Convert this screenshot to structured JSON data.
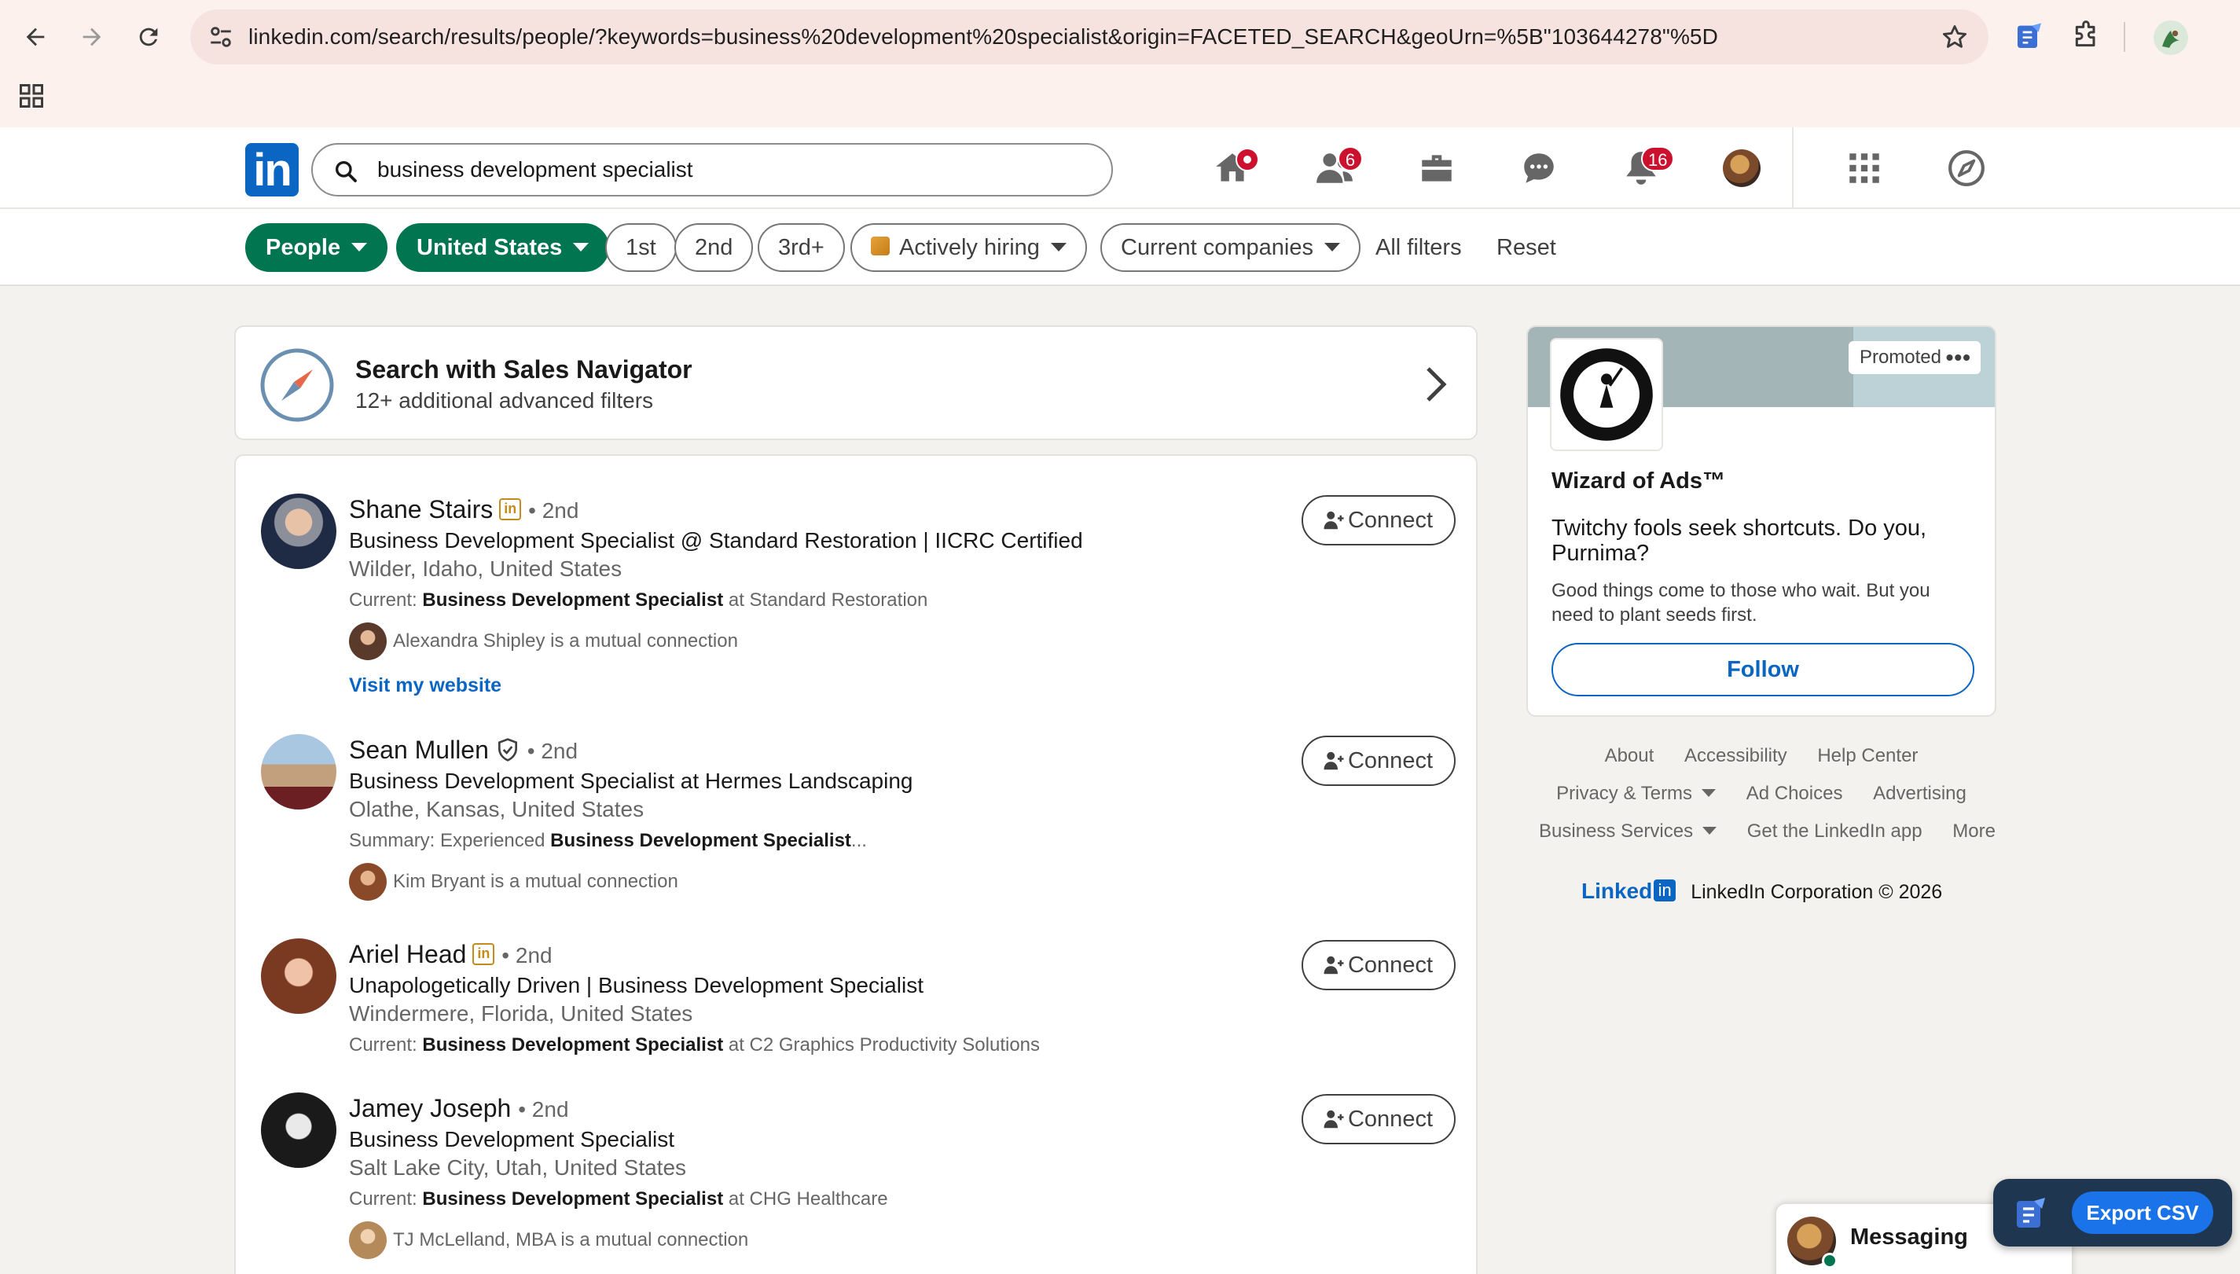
{
  "browser": {
    "url": "linkedin.com/search/results/people/?keywords=business%20development%20specialist&origin=FACETED_SEARCH&geoUrn=%5B\"103644278\"%5D"
  },
  "header": {
    "logo_text": "in",
    "search_value": "business development specialist",
    "badges": {
      "network": "6",
      "notifications": "16"
    }
  },
  "filters": {
    "people": "People",
    "location": "United States",
    "first": "1st",
    "second": "2nd",
    "third": "3rd+",
    "hiring": "Actively hiring",
    "companies": "Current companies",
    "all_filters": "All filters",
    "reset": "Reset"
  },
  "sales_nav": {
    "title": "Search with Sales Navigator",
    "subtitle": "12+ additional advanced filters"
  },
  "results": [
    {
      "name": "Shane Stairs",
      "degree": "• 2nd",
      "headline": "Business Development Specialist @ Standard Restoration | IICRC Certified",
      "location": "Wilder, Idaho, United States",
      "current_prefix": "Current: ",
      "current_bold": "Business Development Specialist",
      "current_suffix": " at Standard Restoration",
      "mutual": "Alexandra Shipley is a mutual connection",
      "link": "Visit my website",
      "connect": "Connect"
    },
    {
      "name": "Sean Mullen",
      "degree": "• 2nd",
      "headline": "Business Development Specialist at Hermes Landscaping",
      "location": "Olathe, Kansas, United States",
      "current_prefix": "Summary: Experienced ",
      "current_bold": "Business Development Specialist",
      "current_suffix": "...",
      "mutual": "Kim Bryant is a mutual connection",
      "connect": "Connect"
    },
    {
      "name": "Ariel Head",
      "degree": "• 2nd",
      "headline": "Unapologetically Driven | Business Development Specialist",
      "location": "Windermere, Florida, United States",
      "current_prefix": "Current: ",
      "current_bold": "Business Development Specialist",
      "current_suffix": " at C2 Graphics Productivity Solutions",
      "connect": "Connect"
    },
    {
      "name": "Jamey Joseph",
      "degree": "• 2nd",
      "headline": "Business Development Specialist",
      "location": "Salt Lake City, Utah, United States",
      "current_prefix": "Current: ",
      "current_bold": "Business Development Specialist",
      "current_suffix": " at CHG Healthcare",
      "mutual": "TJ McLelland, MBA is a mutual connection",
      "connect": "Connect"
    }
  ],
  "ad": {
    "promoted": "Promoted",
    "name": "Wizard of Ads™",
    "tagline": "Twitchy fools seek shortcuts. Do you, Purnima?",
    "description": "Good things come to those who wait. But you need to plant seeds first.",
    "follow": "Follow"
  },
  "footer": {
    "about": "About",
    "accessibility": "Accessibility",
    "help": "Help Center",
    "privacy": "Privacy & Terms",
    "ad_choices": "Ad Choices",
    "advertising": "Advertising",
    "business": "Business Services",
    "app": "Get the LinkedIn app",
    "more": "More",
    "brand_word": "Linked",
    "brand_in": "in",
    "copyright": "LinkedIn Corporation © 2026"
  },
  "messaging": {
    "label": "Messaging"
  },
  "export": {
    "label": "Export CSV"
  },
  "colors": {
    "linkedin_blue": "#0a66c2",
    "filter_green": "#01754f",
    "badge_red": "#cb112d",
    "export_blue": "#1a73e8"
  }
}
